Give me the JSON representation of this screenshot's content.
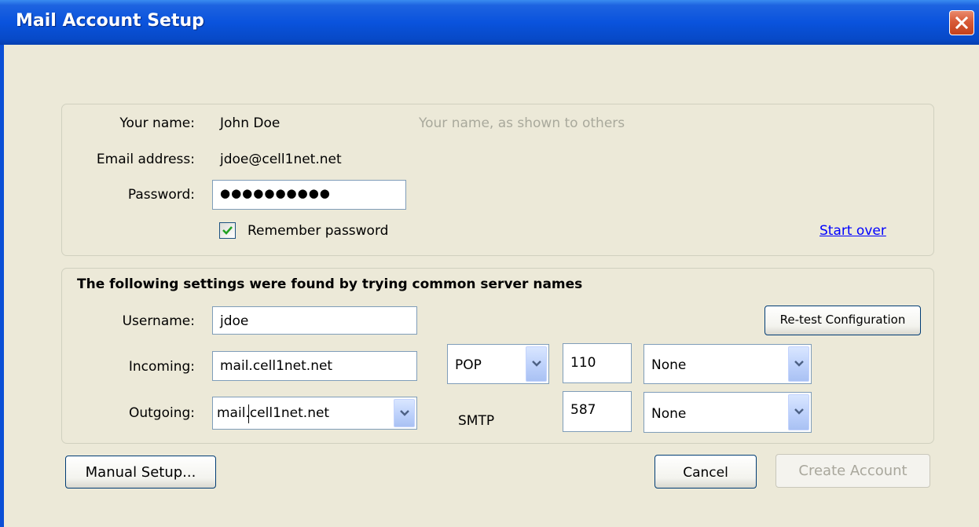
{
  "window": {
    "title": "Mail Account Setup"
  },
  "account": {
    "name_label": "Your name:",
    "name_value": "John Doe",
    "name_hint": "Your name, as shown to others",
    "email_label": "Email address:",
    "email_value": "jdoe@cell1net.net",
    "password_label": "Password:",
    "password_masked": "●●●●●●●●●●",
    "remember_label": "Remember password",
    "remember_checked": true,
    "start_over_label": "Start over"
  },
  "settings": {
    "heading": "The following settings were found by trying common server names",
    "username_label": "Username:",
    "username_value": "jdoe",
    "retest_label": "Re-test Configuration",
    "incoming_label": "Incoming:",
    "incoming_server": "mail.cell1net.net",
    "incoming_protocol": "POP",
    "incoming_port": "110",
    "incoming_security": "None",
    "outgoing_label": "Outgoing:",
    "outgoing_server": "mail.cell1net.net",
    "outgoing_protocol": "SMTP",
    "outgoing_port": "587",
    "outgoing_security": "None"
  },
  "buttons": {
    "manual_setup": "Manual Setup...",
    "cancel": "Cancel",
    "create_account": "Create Account"
  },
  "colors": {
    "titlebar": "#0a53dd",
    "window_bg": "#ece9d8",
    "link": "#0000ff",
    "close_button": "#d85a37"
  }
}
